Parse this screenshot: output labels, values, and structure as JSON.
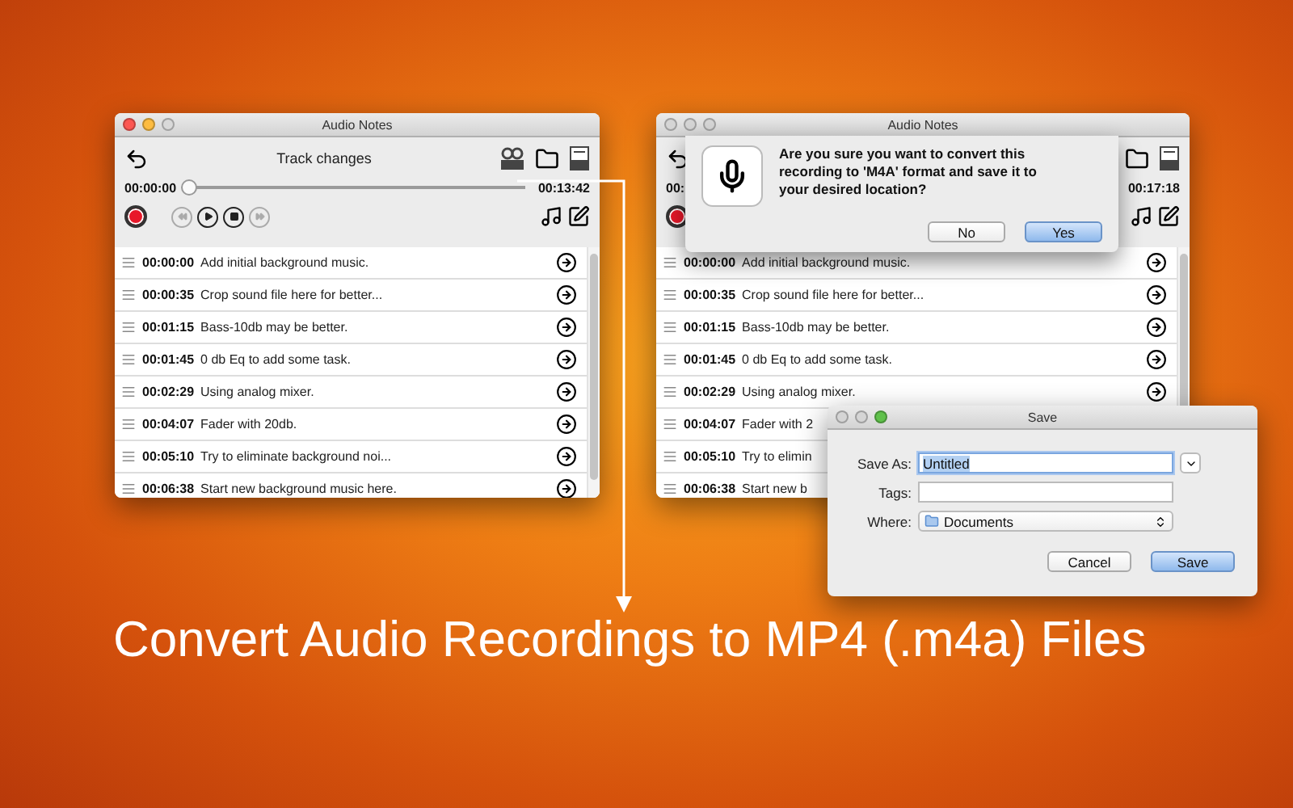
{
  "windows": [
    {
      "title": "Audio Notes",
      "active": true,
      "heading": "Track changes",
      "time_start": "00:00:00",
      "time_end": "00:13:42",
      "level": 0,
      "transport": [
        {
          "kind": "rewind",
          "disabled": true
        },
        {
          "kind": "play",
          "disabled": false
        },
        {
          "kind": "stop",
          "disabled": false
        },
        {
          "kind": "forward",
          "disabled": true
        }
      ],
      "rows": [
        {
          "time": "00:00:00",
          "note": "Add initial background music."
        },
        {
          "time": "00:00:35",
          "note": "Crop sound file here for better..."
        },
        {
          "time": "00:01:15",
          "note": "Bass-10db may be better."
        },
        {
          "time": "00:01:45",
          "note": "0 db Eq to add some task."
        },
        {
          "time": "00:02:29",
          "note": "Using analog mixer."
        },
        {
          "time": "00:04:07",
          "note": "Fader with 20db."
        },
        {
          "time": "00:05:10",
          "note": "Try to eliminate background noi..."
        },
        {
          "time": "00:06:38",
          "note": "Start new background music here."
        }
      ]
    },
    {
      "title": "Audio Notes",
      "active": false,
      "time_start": "00:",
      "time_end": "00:17:18",
      "rows": [
        {
          "time": "00:00:00",
          "note": "Add initial background music."
        },
        {
          "time": "00:00:35",
          "note": "Crop sound file here for better..."
        },
        {
          "time": "00:01:15",
          "note": "Bass-10db may be better."
        },
        {
          "time": "00:01:45",
          "note": "0 db Eq to add some task."
        },
        {
          "time": "00:02:29",
          "note": "Using analog mixer."
        },
        {
          "time": "00:04:07",
          "note": "Fader with 2"
        },
        {
          "time": "00:05:10",
          "note": "Try to elimin"
        },
        {
          "time": "00:06:38",
          "note": "Start new b"
        }
      ]
    }
  ],
  "alert": {
    "message": "Are you sure you want to convert this recording to 'M4A' format and save it to your desired location?",
    "buttons": [
      {
        "label": "No",
        "default": false
      },
      {
        "label": "Yes",
        "default": true
      }
    ]
  },
  "save_dialog": {
    "title": "Save",
    "fields": [
      {
        "label": "Save As:",
        "kind": "text",
        "value": "Untitled",
        "expander": true
      },
      {
        "label": "Tags:",
        "kind": "text"
      },
      {
        "label": "Where:",
        "kind": "popup",
        "value": "Documents"
      }
    ],
    "buttons": [
      {
        "label": "Cancel",
        "default": false
      },
      {
        "label": "Save",
        "default": true
      }
    ]
  },
  "caption": "Convert Audio Recordings to MP4 (.m4a) Files"
}
